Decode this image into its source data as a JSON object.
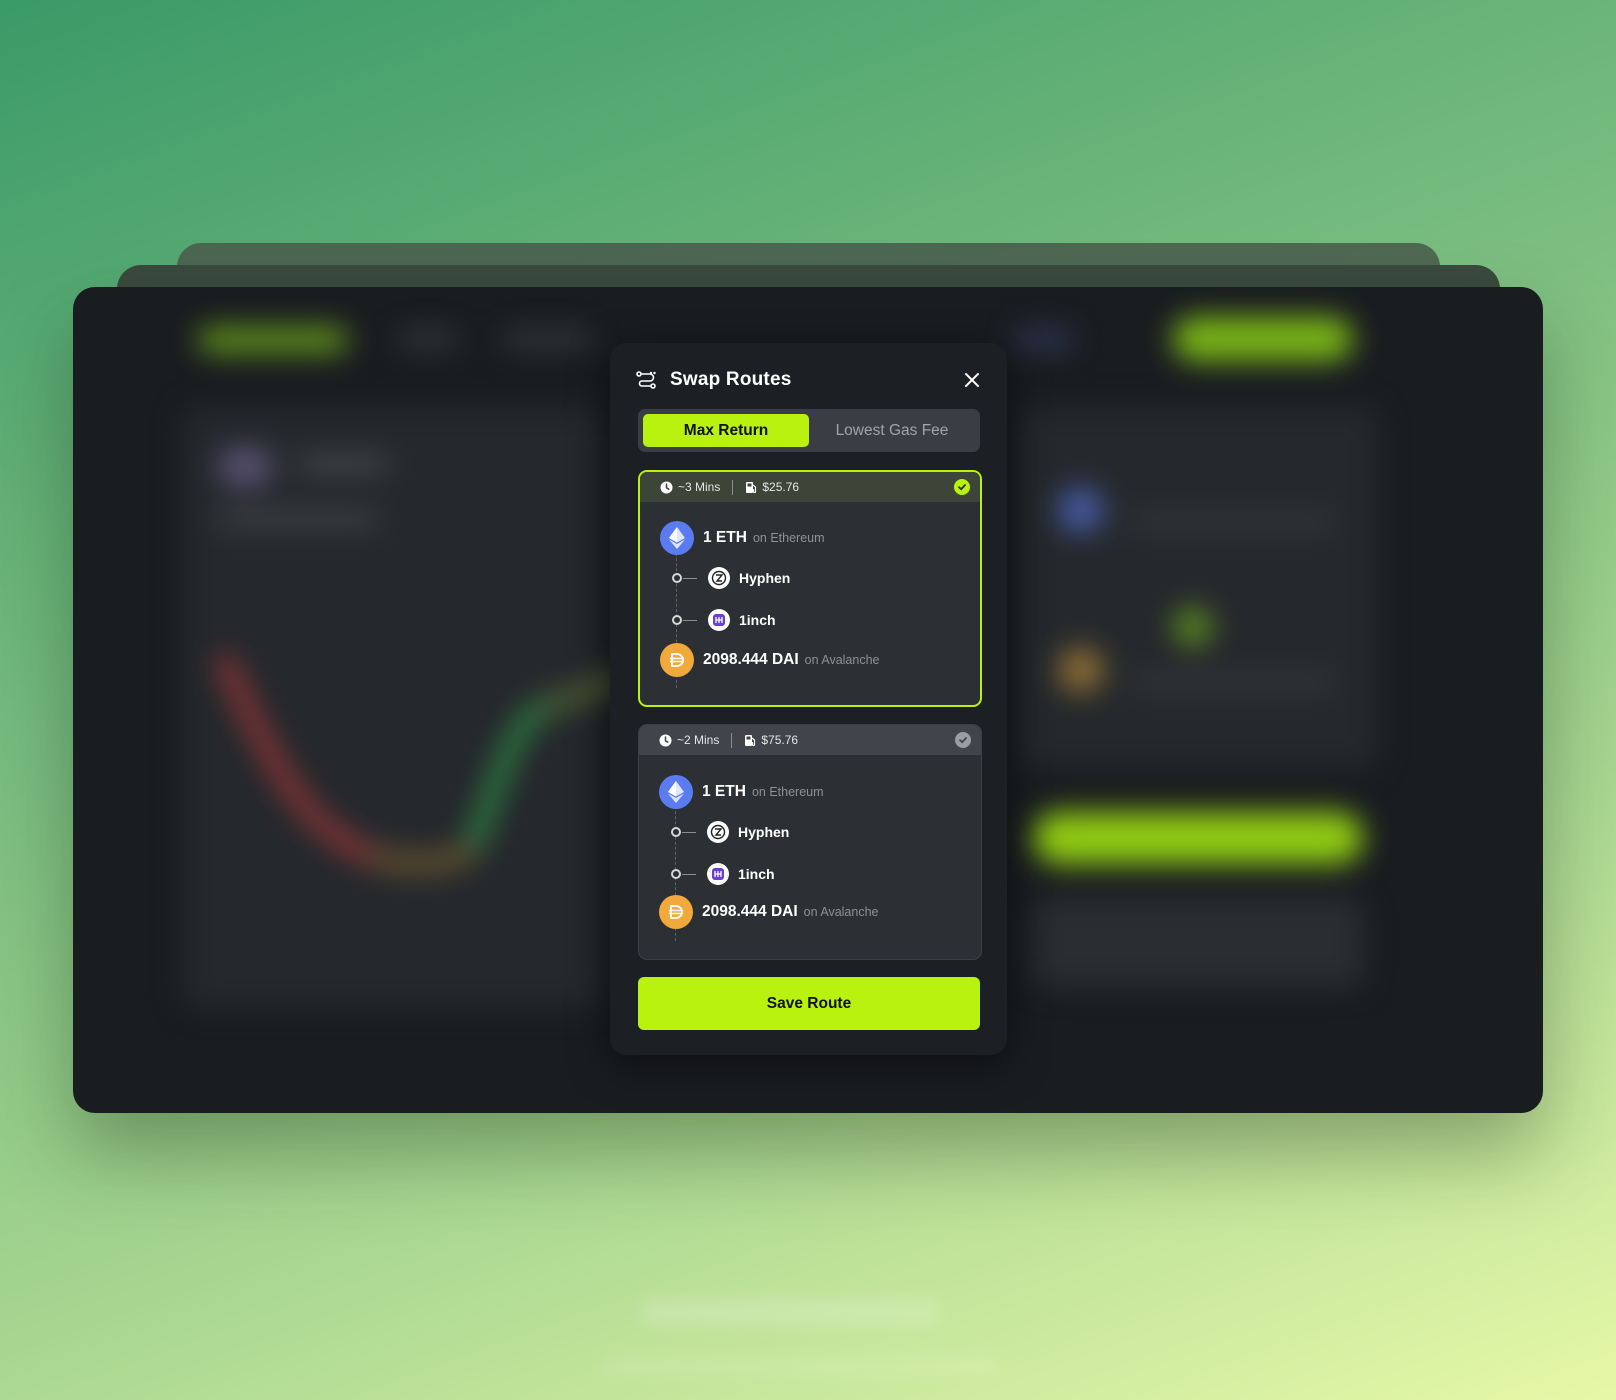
{
  "modal": {
    "title": "Swap Routes",
    "tabs": [
      {
        "label": "Max Return",
        "active": true
      },
      {
        "label": "Lowest Gas Fee",
        "active": false
      }
    ],
    "routes": [
      {
        "selected": true,
        "time": "~3 Mins",
        "gas": "$25.76",
        "from": {
          "amount": "1 ETH",
          "chain": "on Ethereum",
          "icon": "ethereum-icon"
        },
        "hops": [
          {
            "label": "Hyphen",
            "icon": "hyphen-icon"
          },
          {
            "label": "1inch",
            "icon": "1inch-icon"
          }
        ],
        "to": {
          "amount": "2098.444 DAI",
          "chain": "on Avalanche",
          "icon": "dai-icon"
        }
      },
      {
        "selected": false,
        "time": "~2 Mins",
        "gas": "$75.76",
        "from": {
          "amount": "1 ETH",
          "chain": "on Ethereum",
          "icon": "ethereum-icon"
        },
        "hops": [
          {
            "label": "Hyphen",
            "icon": "hyphen-icon"
          },
          {
            "label": "1inch",
            "icon": "1inch-icon"
          }
        ],
        "to": {
          "amount": "2098.444 DAI",
          "chain": "on Avalanche",
          "icon": "dai-icon"
        }
      }
    ],
    "save_label": "Save Route"
  },
  "colors": {
    "accent": "#b8f20e",
    "background": "#1c1f23",
    "card": "#2c2f34",
    "eth": "#5b7cf0",
    "dai": "#f2a93b"
  }
}
